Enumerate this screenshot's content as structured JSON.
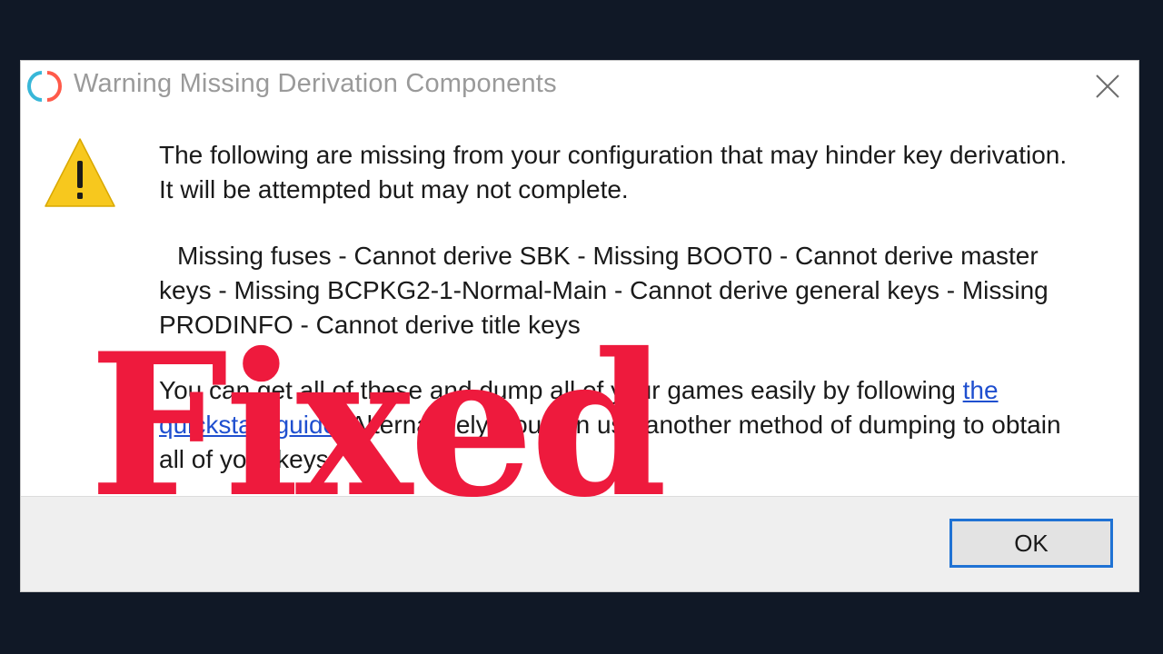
{
  "dialog": {
    "title": "Warning Missing Derivation Components",
    "close_label": "×",
    "message_1": "The following are missing from your configuration that may hinder key derivation. It will be attempted but may not complete.",
    "message_2": "Missing fuses - Cannot derive SBK - Missing BOOT0 - Cannot derive master keys - Missing BCPKG2-1-Normal-Main - Cannot derive general keys - Missing PRODINFO - Cannot derive title keys",
    "message_3_prefix": "You can get all of these and dump all of your games easily by following ",
    "message_3_link": "the quickstart guide",
    "message_3_suffix": ". Alternatively, you can use another method of dumping to obtain all of your keys.",
    "ok_label": "OK"
  },
  "overlay": {
    "text": "Fixed",
    "color": "#ee1a3d"
  },
  "colors": {
    "background": "#101826",
    "accent": "#1f72d4",
    "link": "#1f4fcf",
    "warning": "#f7c81e"
  },
  "icons": {
    "app": "yuzu-logo-icon",
    "warning": "warning-triangle-icon",
    "close": "close-icon"
  }
}
